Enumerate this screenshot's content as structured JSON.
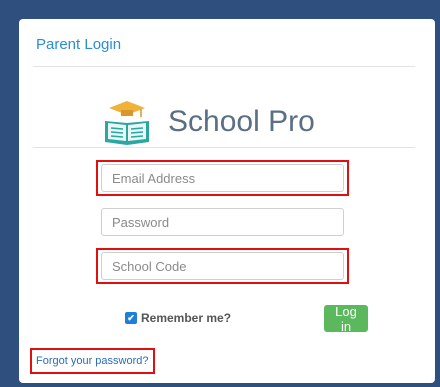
{
  "panel": {
    "title": "Parent Login"
  },
  "brand": {
    "name": "School Pro",
    "icon": "book-graduation-cap-icon"
  },
  "form": {
    "email_placeholder": "Email Address",
    "password_placeholder": "Password",
    "school_code_placeholder": "School Code",
    "remember_label": "Remember me?",
    "remember_checked": true,
    "login_label": "Log in",
    "forgot_label": "Forgot your password?"
  },
  "colors": {
    "accent": "#2a8fd0",
    "button": "#5cb85c",
    "highlight": "#e01010",
    "background": "#2f4f7f"
  }
}
